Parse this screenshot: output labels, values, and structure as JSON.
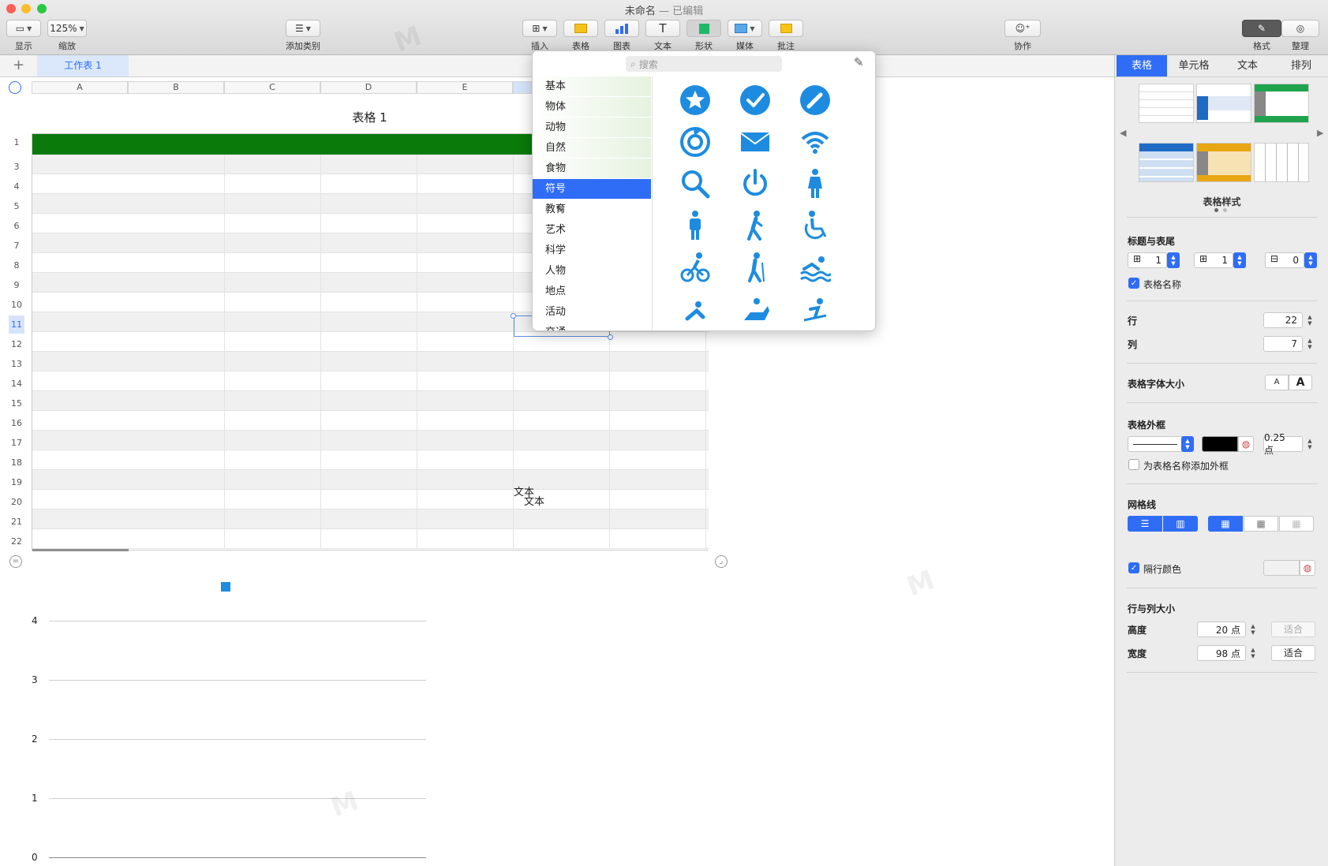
{
  "window": {
    "title": "未命名",
    "edited": "— 已编辑"
  },
  "toolbar": {
    "view": "显示",
    "zoom_value": "125%",
    "zoom_label": "缩放",
    "add_category": "添加类别",
    "insert": "插入",
    "table": "表格",
    "chart": "图表",
    "text": "文本",
    "shape": "形状",
    "media": "媒体",
    "comment": "批注",
    "collaborate": "协作",
    "format": "格式",
    "organize": "整理"
  },
  "sheet": {
    "tab_label": "工作表 1",
    "table_title": "表格 1"
  },
  "columns": [
    "A",
    "B",
    "C",
    "D",
    "E"
  ],
  "rows": [
    "1",
    "3",
    "4",
    "5",
    "6",
    "7",
    "8",
    "9",
    "10",
    "11",
    "12",
    "13",
    "14",
    "15",
    "16",
    "17",
    "18",
    "19",
    "20",
    "21",
    "22"
  ],
  "cells": {
    "text1": "文本",
    "text2": "文本"
  },
  "chart": {
    "y_ticks": [
      "4",
      "3",
      "2",
      "1",
      "0"
    ]
  },
  "popover": {
    "search_placeholder": "搜索",
    "categories": [
      "基本",
      "物体",
      "动物",
      "自然",
      "食物",
      "符号",
      "教育",
      "艺术",
      "科学",
      "人物",
      "地点",
      "活动",
      "交通"
    ],
    "selected": "符号",
    "shapes": [
      "star-circle-icon",
      "checkmark-circle-icon",
      "pencil-circle-icon",
      "refresh-icon",
      "envelope-icon",
      "wifi-icon",
      "magnifier-icon",
      "power-icon",
      "woman-icon",
      "man-icon",
      "walking-icon",
      "wheelchair-icon",
      "cyclist-icon",
      "hiker-icon",
      "swimmer-icon",
      "rower-icon",
      "horse-rider-icon",
      "skier-icon"
    ],
    "accent": "#1d8ce0"
  },
  "inspector": {
    "tabs": [
      "表格",
      "单元格",
      "文本",
      "排列"
    ],
    "styles_label": "表格样式",
    "header_footer": "标题与表尾",
    "header_rows": "1",
    "header_cols": "1",
    "footer_rows": "0",
    "table_name": "表格名称",
    "rows_label": "行",
    "rows_value": "22",
    "cols_label": "列",
    "cols_value": "7",
    "font_size": "表格字体大小",
    "font_small": "A",
    "font_large": "A",
    "outline": "表格外框",
    "outline_width": "0.25 点",
    "outline_title": "为表格名称添加外框",
    "gridlines": "网格线",
    "alt_row": "隔行颜色",
    "row_col_size": "行与列大小",
    "height_label": "高度",
    "height_value": "20 点",
    "width_label": "宽度",
    "width_value": "98 点",
    "fit": "适合"
  },
  "colors": {
    "accent": "#2f6df6",
    "header_green": "#0a7a0a",
    "header_gray": "#8f8f8f"
  }
}
